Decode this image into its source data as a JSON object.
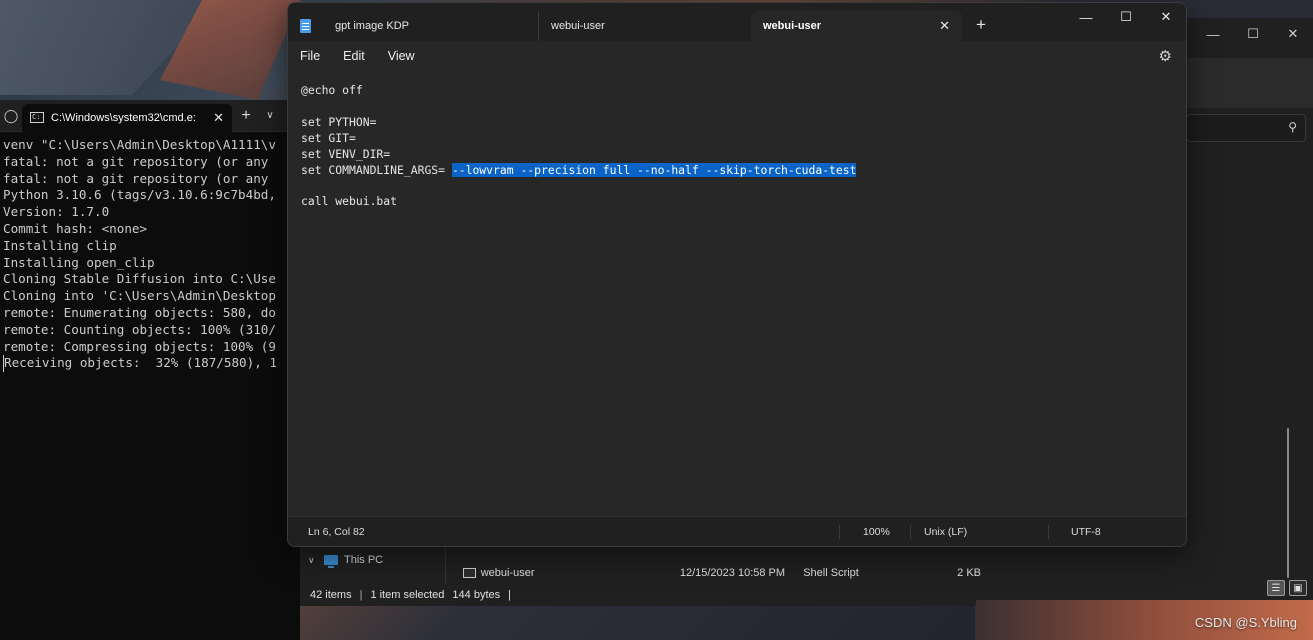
{
  "watermark": "CSDN @S.Ybling",
  "terminal": {
    "tab_title": "C:\\Windows\\system32\\cmd.e:",
    "tab_close_icon": "close-icon",
    "plus": "+",
    "lines": [
      "venv \"C:\\Users\\Admin\\Desktop\\A1111\\v",
      "fatal: not a git repository (or any",
      "fatal: not a git repository (or any",
      "Python 3.10.6 (tags/v3.10.6:9c7b4bd,",
      "Version: 1.7.0",
      "Commit hash: <none>",
      "Installing clip",
      "Installing open_clip",
      "Cloning Stable Diffusion into C:\\Use",
      "Cloning into 'C:\\Users\\Admin\\Desktop",
      "remote: Enumerating objects: 580, do",
      "remote: Counting objects: 100% (310/",
      "remote: Compressing objects: 100% (9",
      "Receiving objects:  32% (187/580), 1"
    ]
  },
  "notepad": {
    "tabs": [
      {
        "label": "gpt image KDP"
      },
      {
        "label": "webui-user"
      },
      {
        "label": "webui-user",
        "active": true
      }
    ],
    "new_tab": "+",
    "menu": [
      "File",
      "Edit",
      "View"
    ],
    "editor": {
      "line1": "@echo off",
      "line2": "",
      "line3": "set PYTHON=",
      "line4": "set GIT=",
      "line5": "set VENV_DIR=",
      "line6_prefix": "set COMMANDLINE_ARGS= ",
      "line6_selected": "--lowvram --precision full --no-half --skip-torch-cuda-test",
      "line7": "",
      "line8": "call webui.bat"
    },
    "selection_color": "#0a64c8",
    "status": {
      "position": "Ln 6, Col 82",
      "zoom": "100%",
      "line_ending": "Unix (LF)",
      "encoding": "UTF-8"
    }
  },
  "explorer": {
    "nav_item": "This PC",
    "row": {
      "name": "webui-user",
      "date": "12/15/2023 10:58 PM",
      "type": "Shell Script",
      "size": "2 KB"
    },
    "status": {
      "items": "42 items",
      "selected": "1 item selected",
      "size": "144 bytes"
    }
  }
}
